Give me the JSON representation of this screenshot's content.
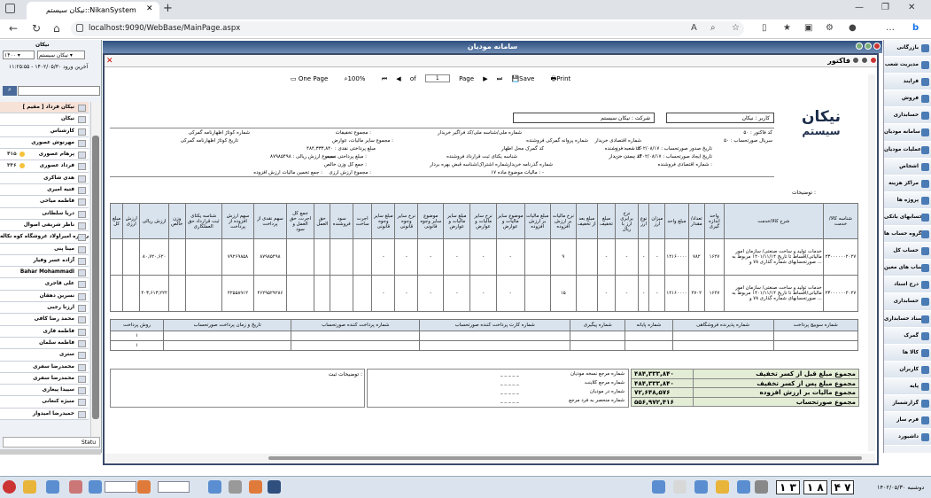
{
  "browser": {
    "tab_title": "نیکان سیستم::NikanSystem",
    "url": "localhost:9090/WebBase/MainPage.aspx",
    "tab_close": "✕",
    "new_tab": "+"
  },
  "left_panel": {
    "title": "نیکان",
    "select_year": "۱۴۰۰",
    "select_company": "نیکان سیستم",
    "last_login": "آخرین ورود ۱۴۰۲/۰۵/۳۰ - ۱۱:۲۵:۵۵",
    "status_label": "Statu",
    "users": [
      {
        "name": "نیکان فرداد [ مقیم ]",
        "count": ""
      },
      {
        "name": "نیکان",
        "count": ""
      },
      {
        "name": "کارشناس",
        "count": ""
      },
      {
        "name": "مهرنوش عصوری",
        "count": ""
      },
      {
        "name": "پرهام عصوری",
        "count": "۴۱۵"
      },
      {
        "name": "فرداد عصوری",
        "count": "۳۳۶"
      },
      {
        "name": "هدی شاکری",
        "count": ""
      },
      {
        "name": "فتیه امیری",
        "count": ""
      },
      {
        "name": "فاطمه میاحی",
        "count": ""
      },
      {
        "name": "دریا سلطانی",
        "count": ""
      },
      {
        "name": "ناظر شریفی اصوال",
        "count": ""
      },
      {
        "name": "سلمی قره امیراولاد غروشگاه کوه نکاله",
        "count": ""
      },
      {
        "name": "مینا پنی",
        "count": ""
      },
      {
        "name": "آزاده عسر وفیار",
        "count": ""
      },
      {
        "name": "Bahar Mohammadi",
        "count": ""
      },
      {
        "name": "علی قاجری",
        "count": ""
      },
      {
        "name": "نسرین دهقان",
        "count": ""
      },
      {
        "name": "ارزنا رجبی",
        "count": ""
      },
      {
        "name": "محمد رضا کافی",
        "count": ""
      },
      {
        "name": "فاطمه فاری",
        "count": ""
      },
      {
        "name": "فاطمه سلمان",
        "count": ""
      },
      {
        "name": "ستری",
        "count": ""
      },
      {
        "name": "محمدرضا سفری",
        "count": ""
      },
      {
        "name": "محمدرضا سفری",
        "count": ""
      },
      {
        "name": "سپیدا پیغاری",
        "count": ""
      },
      {
        "name": "منیژه کنعانی",
        "count": ""
      },
      {
        "name": "حمیدرضا امیدوار",
        "count": ""
      }
    ]
  },
  "app_header": {
    "title": "سامانه مودیان"
  },
  "factor_window": {
    "title": "فاکتور",
    "toolbar": {
      "one_page": "One Page",
      "zoom": "100%",
      "of_label": "of",
      "page_current": "1",
      "page_label": "Page",
      "save": "Save",
      "print": "Print"
    }
  },
  "report": {
    "logo_line1": "نیکان",
    "logo_line2": "سیستم",
    "user_box": "کاربر : نیکان",
    "company_box": "شرکت : نیکان سیستم",
    "header_fields": [
      {
        "label": "کد فاکتور : ۵۰",
        "x": 0
      },
      {
        "label": "سریال صورتحساب : ۵۰",
        "x": 0
      },
      {
        "label": "تاریخ صدور صورتحساب : ۱۴۰۲/۰۸/۱۷ - ۰۰:۰۰:۰۰",
        "x": 0
      },
      {
        "label": "تاریخ ایجاد صورتحساب : ۱۴۰۲/۰۸/۱۷ - ۰۰:۰۰:۰۰",
        "x": 0
      },
      {
        "label": "شماره اقتصادی فروشنده :",
        "x": 0
      },
      {
        "label": "شماره ملی/شناسه ملی/کد فراگیر خریدار",
        "x": 0
      },
      {
        "label": "شماره اقتصادی خریدار",
        "x": 0
      },
      {
        "label": "کد شعبه فروشنده",
        "x": 0
      },
      {
        "label": "کد پستی خریدار",
        "x": 0
      },
      {
        "label": "مالیات موضوع ماده ۱۷ : -",
        "x": 0
      },
      {
        "label": "شماره گذرنامه خریدار",
        "x": 0
      },
      {
        "label": "شماره پروانه گمرکی فروشنده",
        "x": 0
      },
      {
        "label": "کد گمرک محل اظهار",
        "x": 0
      },
      {
        "label": "شناسه یکتای ثبت قرارداد فروشنده",
        "x": 0
      },
      {
        "label": "شماره اشتراک/شناسه قبض بهره بردار",
        "x": 0
      },
      {
        "label": "مجموع تخفیفات :",
        "x": 0
      },
      {
        "label": "مجموع سایر مالیات، عوارض :",
        "x": 0
      },
      {
        "label": "مبلغ پرداختی نقدی : ۴۸۴,۳۳۳,۸۴۰",
        "x": 0
      },
      {
        "label": "مبلغ پرداختی نسیه :",
        "x": 0
      },
      {
        "label": "جمع کل وزن خالص :",
        "x": 0
      },
      {
        "label": "مجموع ارزش ریالی : ۸۷۹۸۵۴۹۸",
        "x": 0
      },
      {
        "label": "مجموع ارزش ارزی :",
        "x": 0
      },
      {
        "label": "جمع تخمین مالیات ارزش افزوده :",
        "x": 0
      },
      {
        "label": "شماره کوتاژ اظهارنامه گمرکی",
        "x": 0
      },
      {
        "label": "تاریخ کوتاژ اظهارنامه گمرکی",
        "x": 0
      }
    ],
    "notes_title": "توضیحات :",
    "table_headers": [
      "شناسه کالا/خدمت",
      "شرح کالا/خدمت",
      "واحد اندازه گیری",
      "تعداد/مقدار",
      "مبلغ واحد",
      "میزان ارز",
      "نوع ارز",
      "نرخ برابری ارز با ریال",
      "مبلغ تخفیف",
      "مبلغ بعد از تخفیف",
      "نرخ مالیات بر ارزش افزوده",
      "مبلغ مالیات بر ارزش افزوده",
      "موضوع سایر مالیات و عوارض",
      "نرخ سایر مالیات و عوارض",
      "مبلغ سایر مالیات و عوارض",
      "موضوع سایر وجوه قانونی",
      "نرخ سایر وجوه قانونی",
      "مبلغ سایر وجوه قانونی",
      "اجرت ساخت",
      "سود فروشنده",
      "حق العمل",
      "جمع کل اجرت، حق العمل و سود",
      "سهم نقدی از پرداخت",
      "سهم ارزش افزوده از پرداخت",
      "شناسه یکتای ثبت قرارداد حق العملکاری",
      "وزن خالص",
      "ارزش ریالی",
      "ارزش ارزی",
      "مبلغ کل"
    ],
    "table_rows": [
      [
        "۲۳۰۰۰۰۰۰۲۰۲۷",
        "خدمات تولید و ساخت صنعتی/ سازمان امور مالیاتی/اقساط تا تاریخ ۱۴۰۱/۱۱/۱۴ مربوط به صورتحسابهای شماره گذاری ۷۸ و ...",
        "۱۶۲۷",
        "۷۸۲",
        "۱۲۱۶۰۰۰۰",
        "-",
        "-",
        "-",
        "-",
        "",
        "۹",
        "",
        "-",
        "-",
        "-",
        "-",
        "-",
        "-",
        "",
        "",
        "",
        "",
        "۸۷۹۸۵۴۹۸",
        "۷۹۲۶۹۸۵۸",
        "",
        "",
        "۸۰,۷۲۰,۶۲۰",
        "",
        ""
      ],
      [
        "۲۳۰۰۰۰۰۰۲۰۲۷",
        "خدمات تولید و ساخت صنعتی/ سازمان امور مالیاتی/اقساط تا تاریخ ۱۴۰۱/۱۱/۱۴ مربوط به صورتحسابهای شماره گذاری ۷۸ و ...",
        "۱۶۲۷",
        "۲۷۰۲",
        "۱۲۱۶۰۰۰۰",
        "-",
        "-",
        "-",
        "-",
        "",
        "۱۵",
        "",
        "-",
        "-",
        "-",
        "-",
        "-",
        "-",
        "",
        "",
        "",
        "",
        "۴۶۲۹۵۲۹۲۸۶",
        "۴۲۵۵۸۹۱۲",
        "",
        "",
        "۴۰۳,۶۱۳,۲۲۲",
        "",
        ""
      ]
    ],
    "payment_headers": [
      "شماره سوییچ پرداخت",
      "شماره پذیرنده فروشگاهی",
      "شماره پایانه",
      "شماره پیگیری",
      "شماره کارت پرداخت کننده صورتحساب",
      "شماره پرداخت کننده صورتحساب",
      "تاریخ و زمان پرداخت صورتحساب",
      "روش پرداخت"
    ],
    "payment_rows": [
      [
        "",
        "",
        "",
        "",
        "",
        "",
        "",
        "۱"
      ],
      [
        "",
        "",
        "",
        "",
        "",
        "",
        "",
        "۱"
      ]
    ],
    "ref_fields": [
      "شماره مرجع نسخه مودیان",
      "شماره مرجع کلاینت",
      "شماره در مودیان",
      "شماره منحصر به فرد مرجع"
    ],
    "notes_label": "توضیحات ثبت :",
    "totals": [
      {
        "label": "مجموع مبلغ قبل از کسر تخفیف",
        "value": "۴۸۴,۳۳۳,۸۴۰"
      },
      {
        "label": "مجموع مبلغ پس از کسر تخفیف",
        "value": "۴۸۴,۳۳۳,۸۴۰"
      },
      {
        "label": "مجموع مالیات بر ارزش افزوده",
        "value": "۷۲,۶۴۸,۵۷۶"
      },
      {
        "label": "مجموع صورتحساب",
        "value": "۵۵۶,۹۷۲,۴۱۶"
      }
    ]
  },
  "right_menu": {
    "items": [
      "بازرگانی",
      "مدیریت شعب",
      "فرایند",
      "فروش",
      "حسابداری",
      "سامانه مودیان",
      "عملیات مودیان",
      "اشخاص",
      "مراکز هزینه",
      "پروژه ها",
      "حسابهای بانکی",
      "گروه حساب ها",
      "حساب کل",
      "حساب های معین",
      "درج اسناد",
      "حسابداری",
      "اسناد حسابداری",
      "گمرک",
      "کالا ها",
      "کاربران",
      "پایه",
      "گزارشساز",
      "فرم ساز",
      "داشبورد"
    ]
  },
  "taskbar": {
    "keys": [
      "۱",
      "۳",
      "۱",
      "۸",
      "۴",
      "۷"
    ],
    "clock": "دوشنبه ۱۴۰۲/۰۵/۳۰"
  }
}
